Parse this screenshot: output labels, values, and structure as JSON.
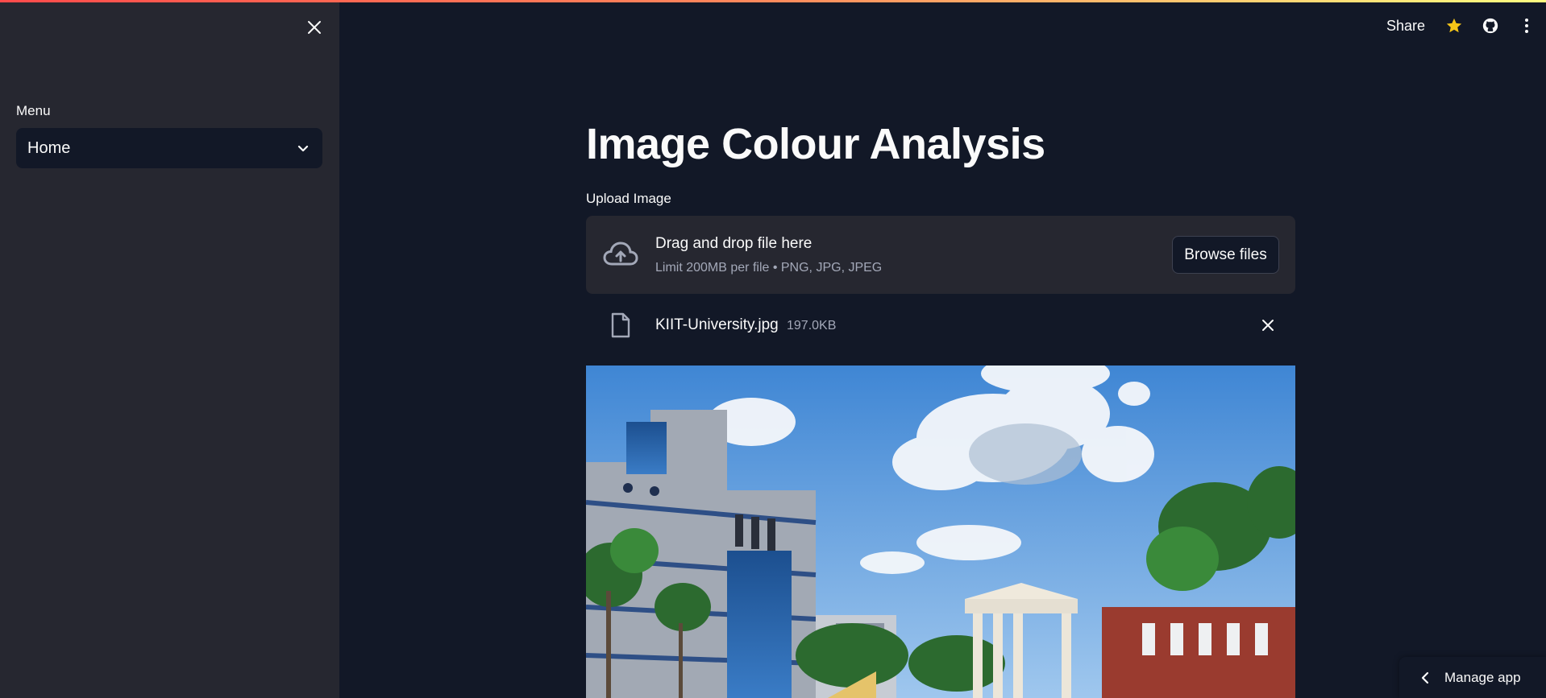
{
  "header": {
    "share_label": "Share",
    "icons": [
      "star-icon",
      "github-icon",
      "more-vert-icon"
    ],
    "accent_star": "#f5c518"
  },
  "sidebar": {
    "menu_label": "Menu",
    "menu_selected": "Home",
    "icons": [
      "close-icon",
      "chevron-down-icon"
    ]
  },
  "main": {
    "title": "Image Colour Analysis",
    "upload": {
      "label": "Upload Image",
      "drop_title": "Drag and drop file here",
      "drop_hint": "Limit 200MB per file • PNG, JPG, JPEG",
      "browse_label": "Browse files",
      "file_name": "KIIT-University.jpg",
      "file_size": "197.0KB"
    }
  },
  "footer": {
    "manage_app_label": "Manage app"
  },
  "colors": {
    "background": "#121827",
    "sidebar": "#262730",
    "dropzone": "#262730",
    "text": "#fafafa",
    "muted_text": "#a3a8b8"
  }
}
